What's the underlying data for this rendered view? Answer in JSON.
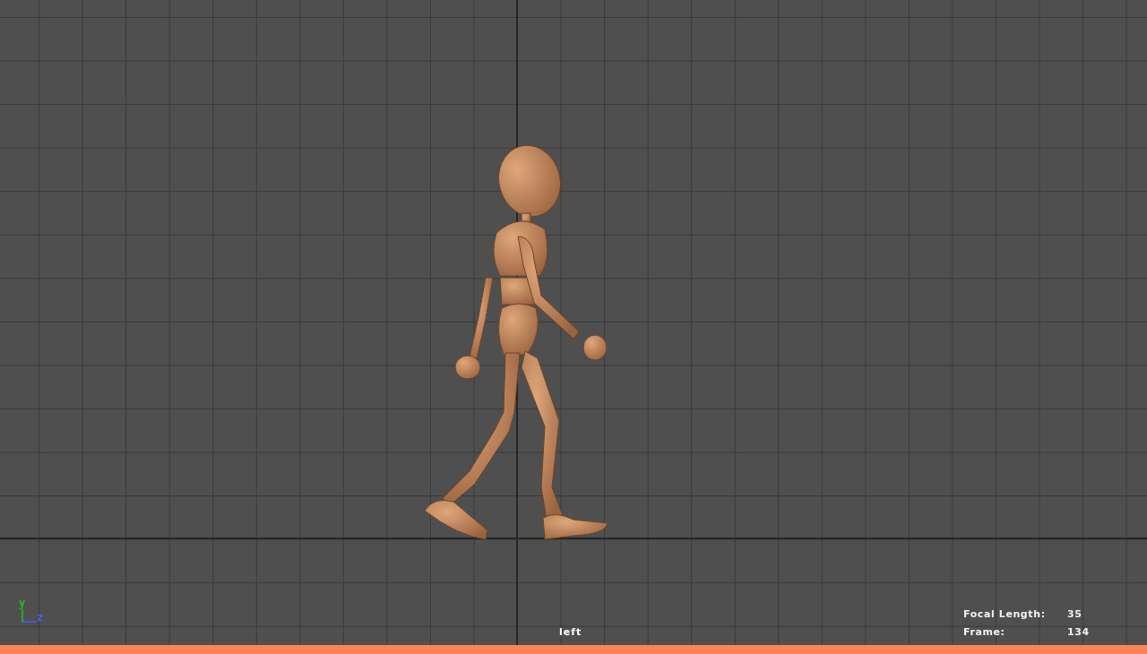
{
  "viewport": {
    "camera": "left",
    "axis_labels": [
      {
        "label": "y",
        "color": "#22c022"
      },
      {
        "label": "z",
        "color": "#4a5cff"
      }
    ],
    "hud": [
      {
        "label": "Focal Length:",
        "value": "35"
      },
      {
        "label": "Frame:",
        "value": "134"
      }
    ]
  },
  "status_bar": {
    "color": "#ff8256"
  }
}
